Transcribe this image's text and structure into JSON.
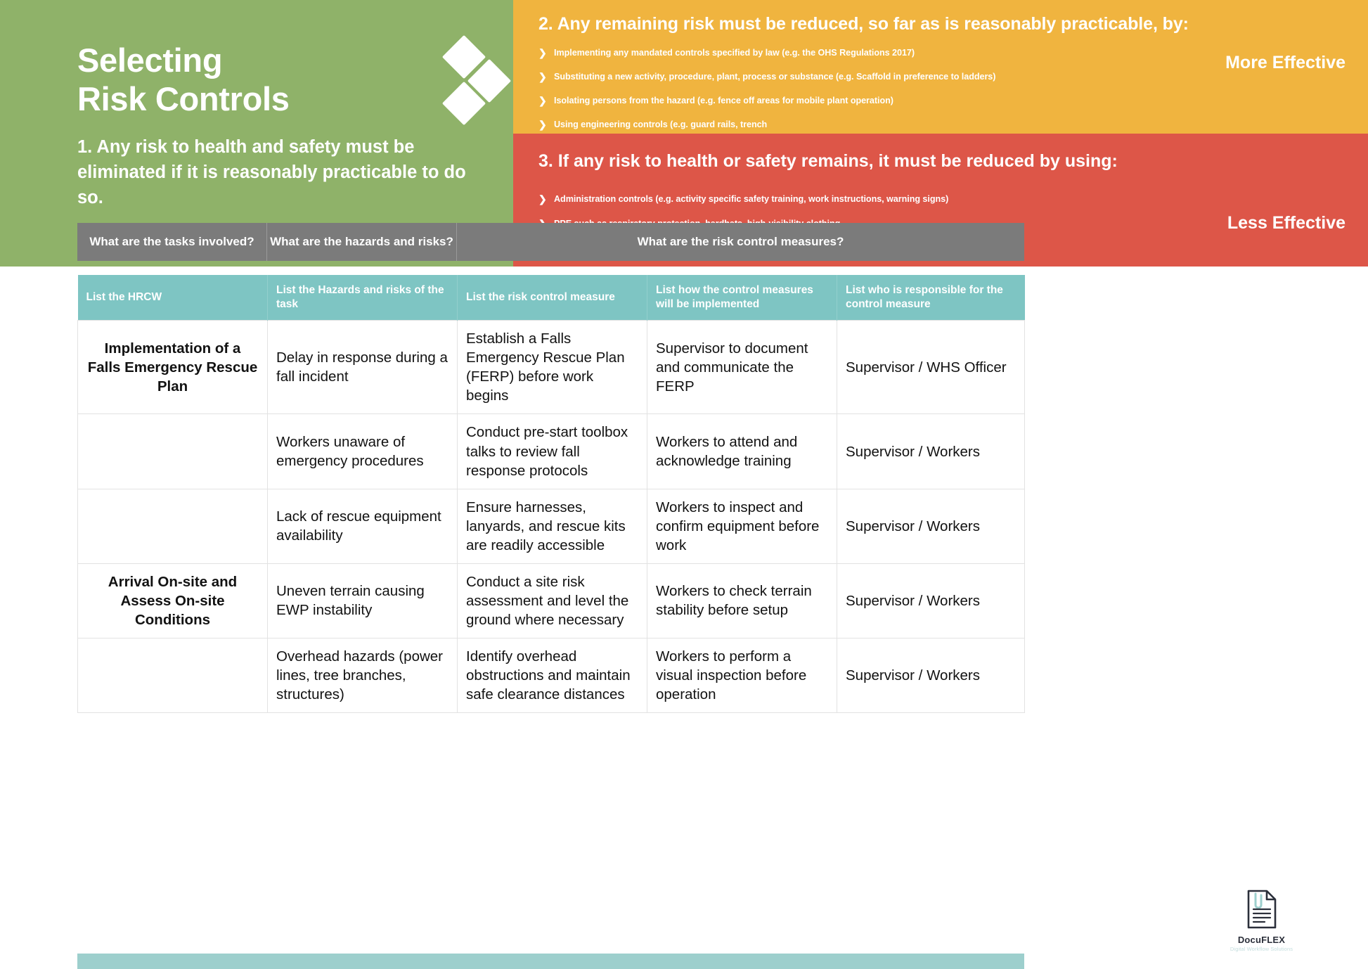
{
  "banner": {
    "title_line1": "Selecting",
    "title_line2": "Risk Controls",
    "principle_1": "1. Any risk to health and safety must be eliminated if it is reasonably practicable to do so.",
    "green_color": "#8fb269",
    "yellow_color": "#f0b43f",
    "red_color": "#dd5648",
    "yellow": {
      "heading": "2. Any remaining risk must be reduced, so far as is reasonably practicable, by:",
      "effectiveness_label": "More Effective",
      "bullets": [
        "Implementing any mandated controls specified by law (e.g. the OHS Regulations 2017)",
        "Substituting a new activity, procedure, plant, process or substance (e.g. Scaffold in preference to ladders)",
        "Isolating persons from the hazard (e.g. fence off areas for mobile plant operation)",
        "Using engineering controls (e.g. guard rails, trench"
      ]
    },
    "red": {
      "heading": "3. If any risk to health or safety remains, it must be reduced by using:",
      "effectiveness_label": "Less Effective",
      "bullets": [
        "Administration controls (e.g. activity specific safety training, work instructions, warning signs)",
        "PPE such as respiratory protection, hardhats, high-visibility clothing."
      ]
    }
  },
  "table": {
    "group_headers": [
      "What are the tasks involved?",
      "What are the hazards and risks?",
      "What are the risk control measures?"
    ],
    "columns": [
      "List the HRCW",
      "List the Hazards and risks of the task",
      "List the risk control measure",
      "List how the control measures will be implemented",
      "List who is responsible for the control measure"
    ],
    "header_color": "#7ec5c3",
    "group_header_color": "#7b7b7b",
    "rows": [
      {
        "task": "Implementation of a Falls Emergency Rescue Plan",
        "hazard": "Delay in response during a fall incident",
        "control": "Establish a Falls Emergency Rescue Plan (FERP) before work begins",
        "implementation": "Supervisor to document and communicate the FERP",
        "responsible": "Supervisor / WHS Officer"
      },
      {
        "task": "",
        "hazard": "Workers unaware of emergency procedures",
        "control": "Conduct pre-start toolbox talks to review fall response protocols",
        "implementation": "Workers to attend and acknowledge training",
        "responsible": "Supervisor / Workers"
      },
      {
        "task": "",
        "hazard": "Lack of rescue equipment availability",
        "control": "Ensure harnesses, lanyards, and rescue kits are readily accessible",
        "implementation": "Workers to inspect and confirm equipment before work",
        "responsible": "Supervisor / Workers"
      },
      {
        "task": "Arrival On-site and Assess On-site Conditions",
        "hazard": "Uneven terrain causing EWP instability",
        "control": "Conduct a site risk assessment and level the ground where necessary",
        "implementation": "Workers to check terrain stability before setup",
        "responsible": "Supervisor / Workers"
      },
      {
        "task": "",
        "hazard": "Overhead hazards (power lines, tree branches, structures)",
        "control": "Identify overhead obstructions and maintain safe clearance distances",
        "implementation": "Workers to perform a visual inspection before operation",
        "responsible": "Supervisor / Workers"
      }
    ]
  },
  "footer": {
    "logo_name": "DocuFLEX",
    "logo_tagline": "Digital Workflow Solutions",
    "bar_color": "#9dcfcd"
  },
  "icons": {
    "chevron": "❯"
  }
}
